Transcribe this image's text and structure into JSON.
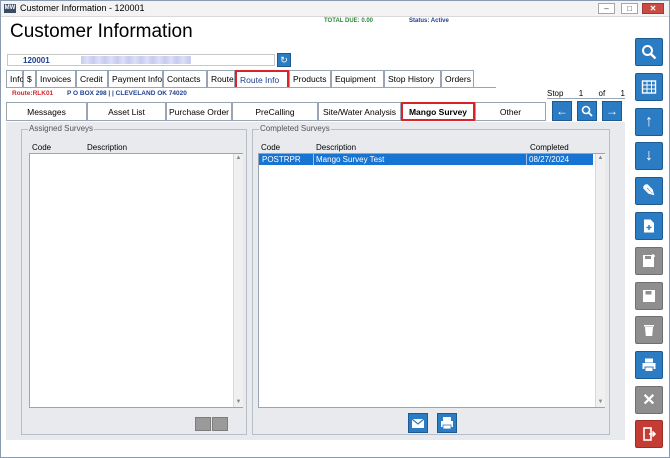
{
  "window": {
    "title": "Customer Information - 120001",
    "app_icon_text": "MW",
    "minimize": "–",
    "maximize": "□",
    "close": "✕"
  },
  "header": {
    "total_due": "TOTAL DUE:  0.00",
    "status": "Status: Active",
    "heading": "Customer Information",
    "customer_number": "120001"
  },
  "tabs_primary": [
    {
      "label": "Info"
    },
    {
      "label": "$"
    },
    {
      "label": "Invoices"
    },
    {
      "label": "Credit"
    },
    {
      "label": "Payment Info"
    },
    {
      "label": "Contacts"
    },
    {
      "label": "Route"
    },
    {
      "label": "Route Info",
      "selected": true
    },
    {
      "label": "Products"
    },
    {
      "label": "Equipment"
    },
    {
      "label": "Stop History"
    },
    {
      "label": "Orders"
    }
  ],
  "route_info": {
    "route": "Route:RLK01",
    "address": "P O BOX 298 |  | CLEVELAND OK 74020"
  },
  "stop": {
    "label": "Stop",
    "current": "1",
    "of_label": "of",
    "total": "1"
  },
  "tabs_secondary": [
    {
      "label": "Messages"
    },
    {
      "label": "Asset List"
    },
    {
      "label": "Purchase Order"
    },
    {
      "label": "PreCalling"
    },
    {
      "label": "Site/Water Analysis"
    },
    {
      "label": "Mango Survey",
      "selected": true
    },
    {
      "label": "Other"
    }
  ],
  "nav_buttons": {
    "prev_icon": "arrow-left-icon",
    "search_icon": "search-icon",
    "next_icon": "arrow-right-icon"
  },
  "assigned_surveys": {
    "legend": "Assigned Surveys",
    "columns": [
      "Code",
      "Description"
    ],
    "rows": []
  },
  "completed_surveys": {
    "legend": "Completed Surveys",
    "columns": [
      "Code",
      "Description",
      "Completed"
    ],
    "rows": [
      {
        "code": "POSTRPR",
        "description": "Mango Survey Test",
        "completed": "08/27/2024"
      }
    ]
  },
  "right_toolbar": [
    {
      "icon": "search-icon",
      "style": "blue"
    },
    {
      "icon": "grid-icon",
      "style": "blue"
    },
    {
      "icon": "arrow-up-icon",
      "style": "blue"
    },
    {
      "icon": "arrow-down-icon",
      "style": "blue"
    },
    {
      "icon": "pencil-icon",
      "style": "blue"
    },
    {
      "icon": "new-document-icon",
      "style": "blue"
    },
    {
      "icon": "save-new-icon",
      "style": "gray"
    },
    {
      "icon": "save-icon",
      "style": "gray"
    },
    {
      "icon": "trash-icon",
      "style": "gray"
    },
    {
      "icon": "print-icon",
      "style": "blue"
    },
    {
      "icon": "cancel-icon",
      "style": "gray"
    },
    {
      "icon": "exit-icon",
      "style": "red"
    }
  ],
  "colors": {
    "accent_blue": "#2c7cc4",
    "selection_blue": "#1874d2",
    "highlight_red": "#d9232a",
    "total_due_green": "#2d8a3a",
    "link_blue": "#1f3e8f"
  }
}
